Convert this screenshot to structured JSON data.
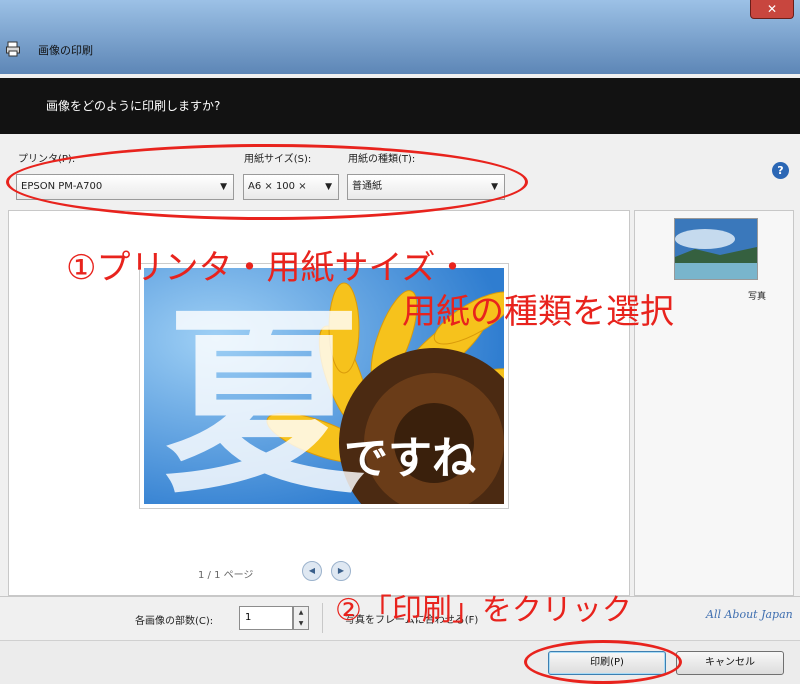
{
  "window": {
    "title": "画像の印刷",
    "close_label": "✕"
  },
  "banner": {
    "text": "画像をどのように印刷しますか?"
  },
  "settings": {
    "printer_label": "プリンタ(P):",
    "printer_value": "EPSON PM-A700",
    "paper_size_label": "用紙サイズ(S):",
    "paper_size_value": "A6 × 100 ×",
    "paper_type_label": "用紙の種類(T):",
    "paper_type_value": "普通紙"
  },
  "preview": {
    "photo_kanji": "夏",
    "photo_text": "ですね",
    "page_indicator": "1 / 1 ページ"
  },
  "thumbnails": [
    {
      "caption": "写真"
    }
  ],
  "options": {
    "copies_label": "各画像の部数(C):",
    "copies_value": "1",
    "fit_label": "写真をフレームに合わせる(F)"
  },
  "signature": "All About Japan",
  "buttons": {
    "print": "印刷(P)",
    "cancel": "キャンセル"
  },
  "annotations": {
    "step1_line1": "①プリンタ・用紙サイズ・",
    "step1_line2": "用紙の種類を選択",
    "step2": "②「印刷」をクリック"
  },
  "colors": {
    "annotation": "#e8231d",
    "banner": "#121212",
    "title_bar": "#7a9ec7"
  },
  "icons": [
    "printer-icon",
    "dropdown-arrow-icon",
    "help-icon",
    "prev-page-icon",
    "next-page-icon",
    "spin-up-icon",
    "spin-down-icon"
  ]
}
